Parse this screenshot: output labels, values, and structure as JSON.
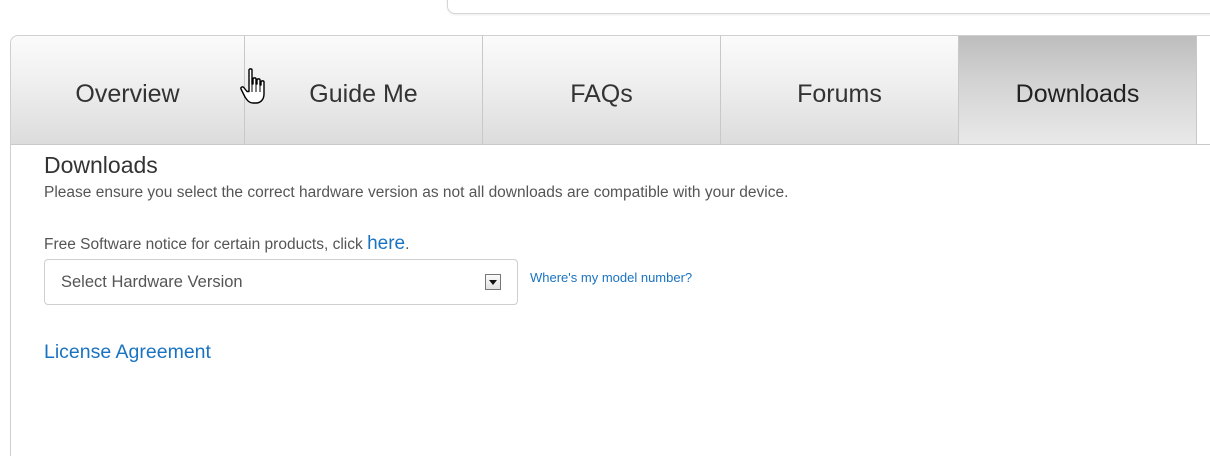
{
  "tabs": [
    {
      "label": "Overview",
      "active": false
    },
    {
      "label": "Guide Me",
      "active": false
    },
    {
      "label": "FAQs",
      "active": false
    },
    {
      "label": "Forums",
      "active": false
    },
    {
      "label": "Downloads",
      "active": true
    }
  ],
  "downloads": {
    "heading": "Downloads",
    "intro": "Please ensure you select the correct hardware version as not all downloads are compatible with your device.",
    "notice_text": "Free Software notice for certain products, click ",
    "notice_link": "here",
    "notice_suffix": ".",
    "hardware_select": {
      "selected": "Select Hardware Version"
    },
    "model_number_link": "Where's my model number?",
    "license_link": "License Agreement"
  },
  "icons": {
    "select_arrow": "dropdown-arrow-icon",
    "cursor": "hand-pointer-icon"
  },
  "colors": {
    "link": "#1a73c2",
    "text": "#333333",
    "active_tab_top": "#bdbdbd"
  }
}
